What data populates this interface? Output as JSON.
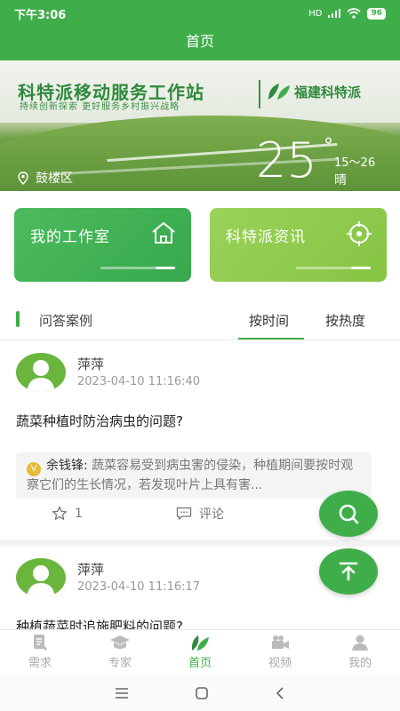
{
  "status_bar": {
    "time": "下午3:06",
    "signal": "HD",
    "battery": "96"
  },
  "header": {
    "title": "首页"
  },
  "banner": {
    "title": "科特派移动服务工作站",
    "subtitle": "持续创新探索  更好服务乡村振兴战略",
    "brand": "福建科特派",
    "district": "鼓楼区",
    "temperature": "25",
    "degree_symbol": "°",
    "temp_range": "15～26",
    "weather": "晴"
  },
  "cards": [
    {
      "label": "我的工作室",
      "icon": "home-icon",
      "color": "#40b352"
    },
    {
      "label": "科特派资讯",
      "icon": "target-icon",
      "color": "#8fca4e"
    }
  ],
  "section": {
    "title": "问答案例",
    "tabs": [
      {
        "label": "按时间",
        "active": true
      },
      {
        "label": "按热度",
        "active": false
      }
    ]
  },
  "posts": [
    {
      "user": "萍萍",
      "time": "2023-04-10 11:16:40",
      "question": "蔬菜种植时防治病虫的问题?",
      "answer": {
        "expert": "余钱锋:",
        "text": "蔬菜容易受到病虫害的侵染，种植期间要按时观察它们的生长情况，若发现叶片上具有害..."
      },
      "likes": "1",
      "comment_label": "评论"
    },
    {
      "user": "萍萍",
      "time": "2023-04-10 11:16:17",
      "question": "种植蔬菜时追施肥料的问题?"
    }
  ],
  "fabs": [
    {
      "icon": "search-icon"
    },
    {
      "icon": "arrow-up-icon"
    }
  ],
  "tabbar": [
    {
      "label": "需求",
      "icon": "document-icon",
      "active": false
    },
    {
      "label": "专家",
      "icon": "graduation-cap-icon",
      "active": false
    },
    {
      "label": "首页",
      "icon": "leaf-icon",
      "active": true
    },
    {
      "label": "视频",
      "icon": "video-camera-icon",
      "active": false
    },
    {
      "label": "我的",
      "icon": "person-icon",
      "active": false
    }
  ],
  "colors": {
    "primary": "#3fae4a",
    "accent_light": "#8fca4e",
    "badge": "#e8b93a"
  }
}
